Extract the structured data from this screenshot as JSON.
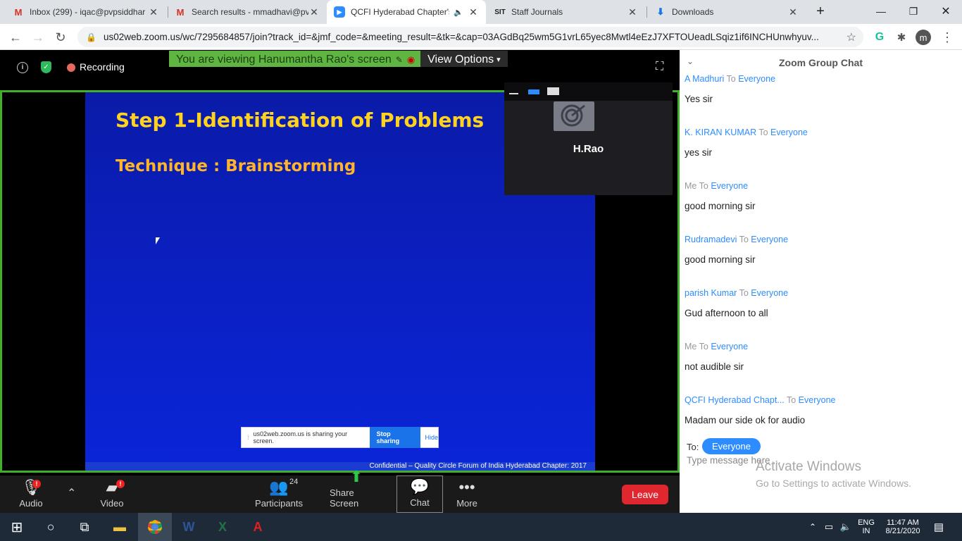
{
  "browser": {
    "tabs": [
      {
        "title": "Inbox (299) - iqac@pvpsiddhar",
        "icon": "gmail-icon"
      },
      {
        "title": "Search results - mmadhavi@pv",
        "icon": "gmail-icon"
      },
      {
        "title": "QCFI Hyderabad Chapter's",
        "icon": "zoom-icon",
        "active": true
      },
      {
        "title": "Staff Journals",
        "icon": "site-icon"
      },
      {
        "title": "Downloads",
        "icon": "download-icon"
      }
    ],
    "url": "us02web.zoom.us/wc/7295684857/join?track_id=&jmf_code=&meeting_result=&tk=&cap=03AGdBq25wm5G1vrL65yec8Mwtl4eEzJ7XFTOUeadLSqiz1if6INCHUnwhyuv...",
    "profile_initial": "m"
  },
  "meeting": {
    "recording_label": "Recording",
    "share_banner": "You are viewing Hanumantha Rao's screen",
    "view_options": "View Options",
    "slide": {
      "title": "Step 1-Identification of Problems",
      "subtitle": "Technique : Brainstorming",
      "footer": "Confidential – Quality Circle Forum of India Hyderabad Chapter: 2017"
    },
    "share_note": {
      "text": "us02web.zoom.us is sharing your screen.",
      "stop": "Stop sharing",
      "hide": "Hide"
    },
    "video_tile_name": "H.Rao"
  },
  "toolbar": {
    "audio": "Audio",
    "video": "Video",
    "participants": "Participants",
    "participants_count": "24",
    "share": "Share Screen",
    "chat": "Chat",
    "more": "More",
    "leave": "Leave",
    "badge": "!"
  },
  "chat": {
    "title": "Zoom Group Chat",
    "to_word": "To",
    "messages": [
      {
        "from": "A Madhuri",
        "to": "Everyone",
        "text": "Yes sir",
        "me": false
      },
      {
        "from": "K. KIRAN KUMAR",
        "to": "Everyone",
        "text": "yes sir",
        "me": false
      },
      {
        "from": "Me",
        "to": "Everyone",
        "text": "good morning sir",
        "me": true
      },
      {
        "from": "Rudramadevi",
        "to": "Everyone",
        "text": "good morning sir",
        "me": false
      },
      {
        "from": "parish Kumar",
        "to": "Everyone",
        "text": "Gud afternoon to all",
        "me": false
      },
      {
        "from": "Me",
        "to": "Everyone",
        "text": "not audible sir",
        "me": true
      },
      {
        "from": "QCFI Hyderabad Chapt...",
        "to": "Everyone",
        "text": "Madam our side ok for audio",
        "me": false
      }
    ],
    "to_label": "To:",
    "recipient": "Everyone",
    "input_placeholder": "Type message here ..."
  },
  "watermark": {
    "line1": "Activate Windows",
    "line2": "Go to Settings to activate Windows."
  },
  "taskbar": {
    "lang1": "ENG",
    "lang2": "IN",
    "time": "11:47 AM",
    "date": "8/21/2020"
  },
  "colors": {
    "zoom_blue": "#2d8cff",
    "share_green": "#5fb541",
    "leave_red": "#e0262e",
    "slide_title": "#ffd21f"
  }
}
